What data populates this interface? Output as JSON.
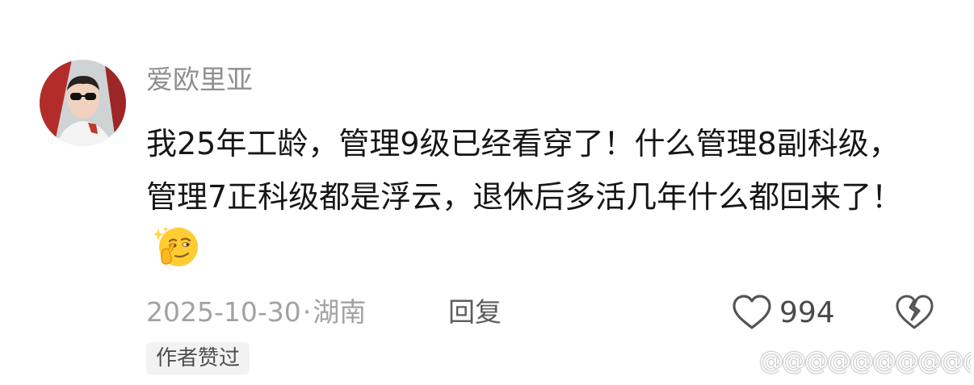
{
  "comment": {
    "username": "爱欧里亚",
    "text": "我25年工龄，管理9级已经看穿了！什么管理8副科级，管理7正科级都是浮云，退休后多活几年什么都回来了！",
    "emoji_icon": "thinking-smirk-emoji-icon",
    "date": "2025-10-30",
    "separator": "·",
    "location": "湖南",
    "reply_label": "回复",
    "like_count": "994",
    "author_badge": "作者赞过",
    "watermark": "@@@@@@@@@@@@@@@@@@@@"
  },
  "colors": {
    "username": "#8f8f8f",
    "text": "#161616",
    "meta": "#a2a2a2",
    "badge_bg": "#f2f2f2"
  }
}
